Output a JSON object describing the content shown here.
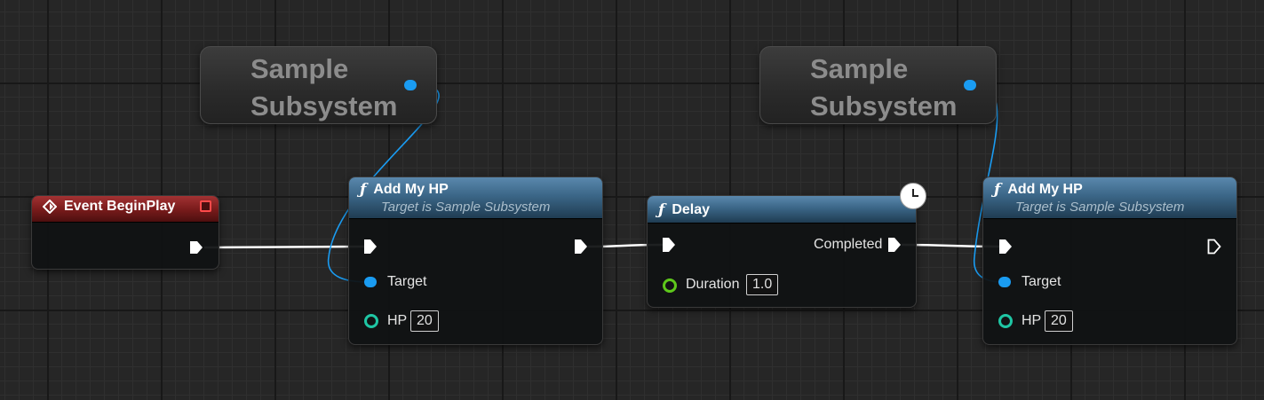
{
  "getters": [
    {
      "label_line1": "Sample",
      "label_line2": "Subsystem"
    },
    {
      "label_line1": "Sample",
      "label_line2": "Subsystem"
    }
  ],
  "event_node": {
    "title": "Event BeginPlay"
  },
  "add_hp_1": {
    "title": "Add My HP",
    "subtitle": "Target is Sample Subsystem",
    "target_label": "Target",
    "hp_label": "HP",
    "hp_value": "20"
  },
  "delay_node": {
    "title": "Delay",
    "completed_label": "Completed",
    "duration_label": "Duration",
    "duration_value": "1.0"
  },
  "add_hp_2": {
    "title": "Add My HP",
    "subtitle": "Target is Sample Subsystem",
    "target_label": "Target",
    "hp_label": "HP",
    "hp_value": "20"
  },
  "icons": {
    "function": "function-icon",
    "event": "event-diamond-icon",
    "latent": "clock-icon",
    "stop": "stop-icon"
  },
  "colors": {
    "object_pin": "#1a9cf2",
    "integer_pin": "#1fc6a4",
    "float_pin": "#5ec81b",
    "exec_wire": "#ffffff",
    "function_header": "#3b6687",
    "event_header": "#7b1c1c"
  }
}
